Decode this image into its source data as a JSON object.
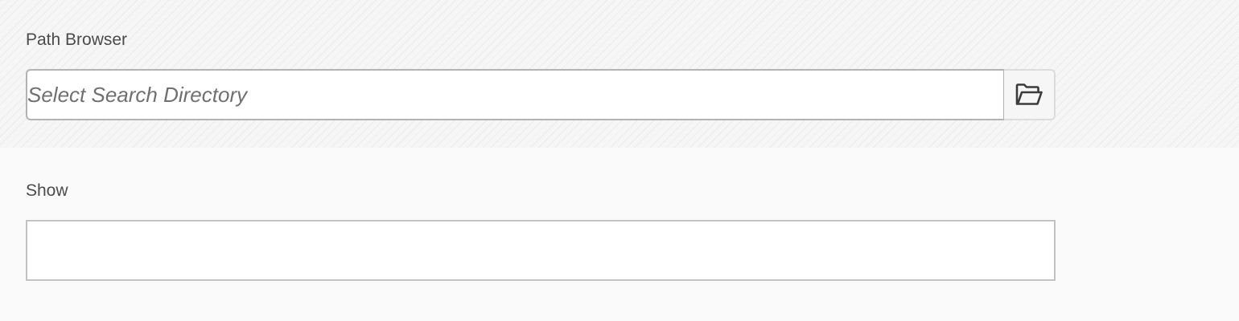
{
  "path_browser": {
    "label": "Path Browser",
    "placeholder": "Select Search Directory",
    "value": "",
    "browse_icon": "folder-open-icon"
  },
  "show": {
    "label": "Show",
    "value": ""
  }
}
